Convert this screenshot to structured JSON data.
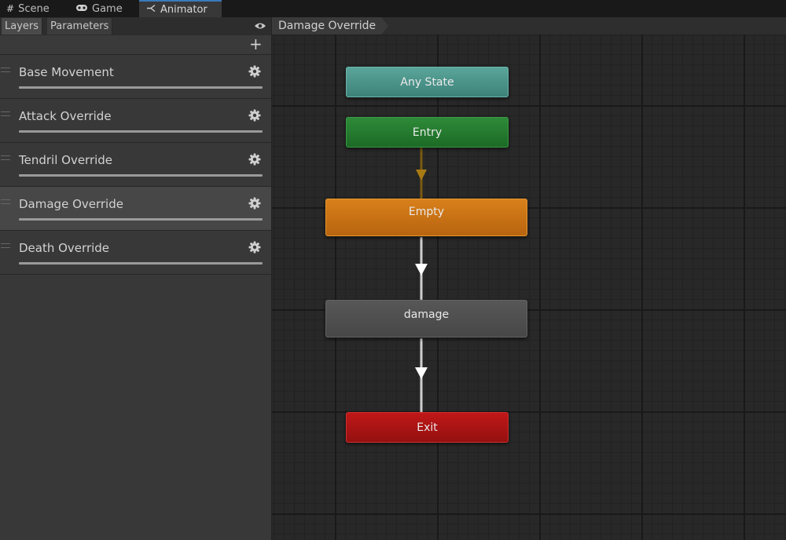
{
  "tabs": [
    {
      "label": "Scene",
      "icon": "grid-icon"
    },
    {
      "label": "Game",
      "icon": "gamepad-icon"
    },
    {
      "label": "Animator",
      "icon": "animator-icon",
      "active": true
    }
  ],
  "left_panel": {
    "subtabs": [
      {
        "label": "Layers",
        "selected": true
      },
      {
        "label": "Parameters"
      }
    ],
    "eye_icon": "eye-icon",
    "add_icon": "plus-icon",
    "layers": [
      {
        "name": "Base Movement"
      },
      {
        "name": "Attack Override"
      },
      {
        "name": "Tendril Override"
      },
      {
        "name": "Damage Override",
        "selected": true
      },
      {
        "name": "Death Override"
      }
    ]
  },
  "graph": {
    "breadcrumb": "Damage Override",
    "states": {
      "any_state": "Any State",
      "entry": "Entry",
      "empty": "Empty",
      "damage": "damage",
      "exit": "Exit"
    }
  },
  "colors": {
    "any_state": "#4a9a90",
    "entry": "#237a2e",
    "default_state": "#c97115",
    "state": "#4f4f4f",
    "exit": "#aa1414",
    "default_transition": "#7a5a10",
    "transition": "#cfcfcf",
    "active_tab_accent": "#3a79bb"
  }
}
